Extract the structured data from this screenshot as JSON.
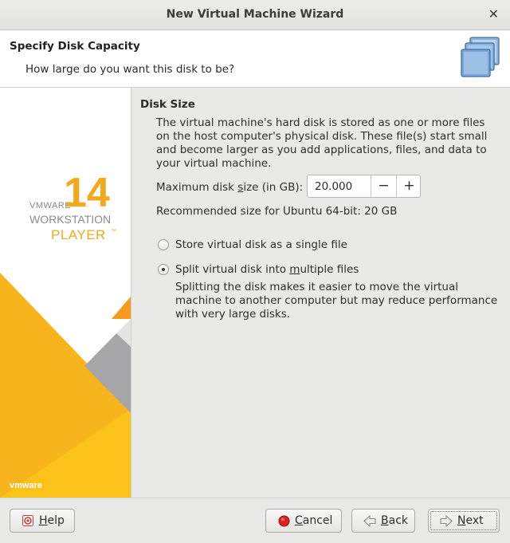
{
  "window": {
    "title": "New Virtual Machine Wizard",
    "close_glyph": "✕"
  },
  "header": {
    "title": "Specify Disk Capacity",
    "subtitle": "How large do you want this disk to be?",
    "icon": "stacked-disks-icon"
  },
  "sidebar": {
    "brand_small": "VMWARE",
    "version": "14",
    "product_line1": "WORKSTATION",
    "product_line2": "PLAYER",
    "trademark": "™",
    "footer_logo": "vmware",
    "colors": {
      "orange": "#f6a623",
      "yellow": "#fbc21a",
      "gray": "#a6a6a8"
    }
  },
  "section": {
    "title": "Disk Size",
    "description": "The virtual machine's hard disk is stored as one or more files on the host computer's physical disk. These file(s) start small and become larger as you add applications, files, and data to your virtual machine."
  },
  "disk_size": {
    "label_prefix": "Maximum disk ",
    "label_mnemonic": "s",
    "label_suffix": "ize (in GB):",
    "value": "20.000",
    "decrement": "−",
    "increment": "+",
    "recommendation": "Recommended size for Ubuntu 64-bit: 20 GB"
  },
  "storage_options": {
    "single": {
      "prefix": "Store virtual disk as a sin",
      "mnemonic": "g",
      "suffix": "le file",
      "selected": false
    },
    "split": {
      "prefix": "Split virtual disk into ",
      "mnemonic": "m",
      "suffix": "ultiple files",
      "selected": true
    },
    "split_description": "Splitting the disk makes it easier to move the virtual machine to another computer but may reduce performance with very large disks."
  },
  "buttons": {
    "help": {
      "mnemonic": "H",
      "rest": "elp"
    },
    "cancel": {
      "mnemonic": "C",
      "rest": "ancel"
    },
    "back": {
      "mnemonic": "B",
      "rest": "ack"
    },
    "next": {
      "mnemonic": "N",
      "rest": "ext"
    }
  }
}
